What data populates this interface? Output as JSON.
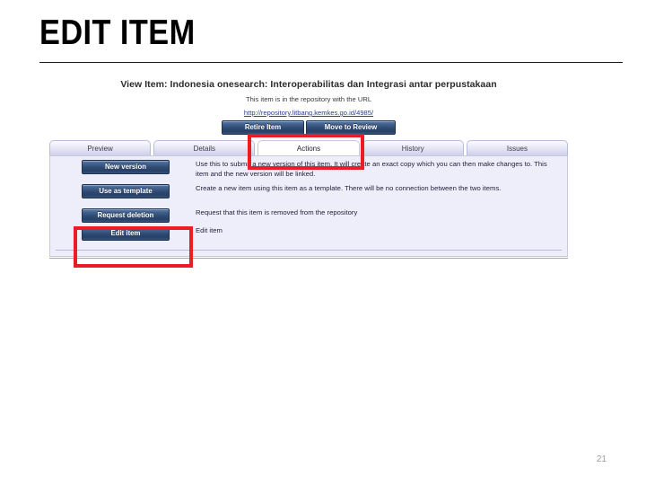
{
  "slide": {
    "title": "EDIT ITEM",
    "page_number": "21"
  },
  "screenshot": {
    "header": {
      "view_item_title": "View Item: Indonesia onesearch: Interoperabilitas dan Integrasi antar perpustakaan",
      "repository_note": "This item is in the repository with the URL",
      "repository_url": "http://repository.litbang.kemkes.go.id/4985/"
    },
    "top_buttons": [
      {
        "label": "Retire Item"
      },
      {
        "label": "Move to Review"
      }
    ],
    "tabs": [
      {
        "label": "Preview",
        "active": false
      },
      {
        "label": "Details",
        "active": false
      },
      {
        "label": "Actions",
        "active": true
      },
      {
        "label": "History",
        "active": false
      },
      {
        "label": "Issues",
        "active": false
      }
    ],
    "actions": [
      {
        "button": "New version",
        "description": "Use this to submit a new version of this item. It will create an exact copy which you can then make changes to. This item and the new version will be linked."
      },
      {
        "button": "Use as template",
        "description": "Create a new item using this item as a template. There will be no connection between the two items."
      },
      {
        "button": "Request deletion",
        "description": "Request that this item is removed from the repository"
      },
      {
        "button": "Edit item",
        "description": "Edit item"
      }
    ]
  },
  "annotations": {
    "accent_color": "#ec1c24",
    "highlighted": [
      "Actions tab",
      "Edit item button"
    ]
  }
}
